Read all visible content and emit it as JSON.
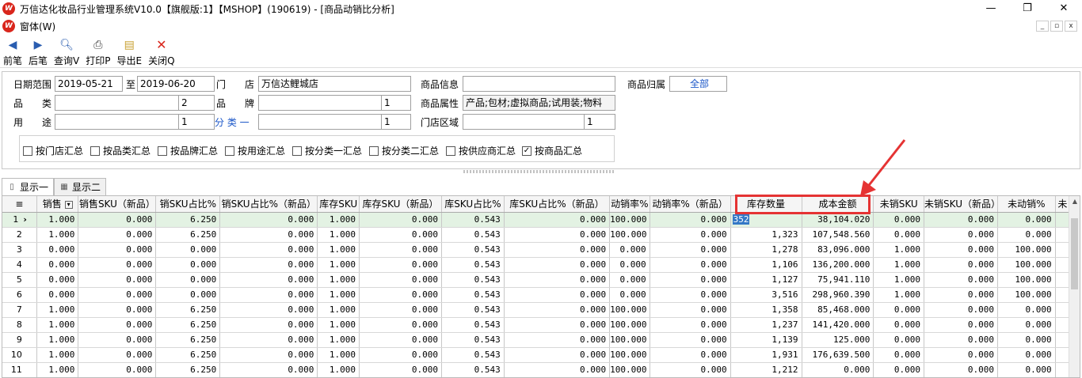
{
  "window": {
    "title": "万信达化妆品行业管理系统V10.0【旗舰版:1】【MSHOP】(190619) - [商品动销比分析]",
    "controls": [
      "—",
      "❐",
      "✕"
    ]
  },
  "menu": {
    "window_label": "窗体(W)",
    "mdi_controls": [
      "_",
      "▫",
      "x"
    ]
  },
  "toolbar": {
    "prev": "前笔",
    "next": "后笔",
    "query": "查询V",
    "print": "打印P",
    "export": "导出E",
    "close": "关闭Q"
  },
  "filter": {
    "date_range_label": "日期范围",
    "date_from": "2019-05-21",
    "to_label": "至",
    "date_to": "2019-06-20",
    "store_label": "门　　店",
    "store_value": "万信达鲤城店",
    "product_info_label": "商品信息",
    "product_info_value": "",
    "product_owner_label": "商品归属",
    "product_owner_value": "全部",
    "category_label": "品　　类",
    "category_num": "2",
    "brand_label": "品　　牌",
    "brand_num": "1",
    "product_attr_label": "商品属性",
    "product_attr_value": "产品;包材;虚拟商品;试用装;物料",
    "usage_label": "用　　途",
    "usage_num": "1",
    "class_label": "分 类 一",
    "class_num": "1",
    "area_label": "门店区域",
    "area_num": "1",
    "checkboxes": [
      {
        "label": "按门店汇总",
        "checked": false
      },
      {
        "label": "按品类汇总",
        "checked": false
      },
      {
        "label": "按品牌汇总",
        "checked": false
      },
      {
        "label": "按用途汇总",
        "checked": false
      },
      {
        "label": "按分类一汇总",
        "checked": false
      },
      {
        "label": "按分类二汇总",
        "checked": false
      },
      {
        "label": "按供应商汇总",
        "checked": false
      },
      {
        "label": "按商品汇总",
        "checked": true
      }
    ]
  },
  "tabs": [
    "显示一",
    "显示二"
  ],
  "grid": {
    "columns": [
      "销售",
      "销售SKU（新品）",
      "销SKU占比%",
      "销SKU占比%（新品）",
      "库存SKU",
      "库存SKU（新品）",
      "库SKU占比%",
      "库SKU占比%（新品）",
      "动销率%",
      "动销率%（新品）",
      "库存数量",
      "成本金额",
      "未销SKU",
      "未销SKU（新品）",
      "未动销%",
      "未"
    ],
    "rows": [
      [
        "1",
        "1.000",
        "0.000",
        "6.250",
        "0.000",
        "1.000",
        "0.000",
        "0.543",
        "0.000",
        "100.000",
        "0.000",
        "352",
        "38,104.020",
        "0.000",
        "0.000",
        "0.000"
      ],
      [
        "2",
        "1.000",
        "0.000",
        "6.250",
        "0.000",
        "1.000",
        "0.000",
        "0.543",
        "0.000",
        "100.000",
        "0.000",
        "1,323",
        "107,548.560",
        "0.000",
        "0.000",
        "0.000"
      ],
      [
        "3",
        "0.000",
        "0.000",
        "0.000",
        "0.000",
        "1.000",
        "0.000",
        "0.543",
        "0.000",
        "0.000",
        "0.000",
        "1,278",
        "83,096.000",
        "1.000",
        "0.000",
        "100.000"
      ],
      [
        "4",
        "0.000",
        "0.000",
        "0.000",
        "0.000",
        "1.000",
        "0.000",
        "0.543",
        "0.000",
        "0.000",
        "0.000",
        "1,106",
        "136,200.000",
        "1.000",
        "0.000",
        "100.000"
      ],
      [
        "5",
        "0.000",
        "0.000",
        "0.000",
        "0.000",
        "1.000",
        "0.000",
        "0.543",
        "0.000",
        "0.000",
        "0.000",
        "1,127",
        "75,941.110",
        "1.000",
        "0.000",
        "100.000"
      ],
      [
        "6",
        "0.000",
        "0.000",
        "0.000",
        "0.000",
        "1.000",
        "0.000",
        "0.543",
        "0.000",
        "0.000",
        "0.000",
        "3,516",
        "298,960.390",
        "1.000",
        "0.000",
        "100.000"
      ],
      [
        "7",
        "1.000",
        "0.000",
        "6.250",
        "0.000",
        "1.000",
        "0.000",
        "0.543",
        "0.000",
        "100.000",
        "0.000",
        "1,358",
        "85,468.000",
        "0.000",
        "0.000",
        "0.000"
      ],
      [
        "8",
        "1.000",
        "0.000",
        "6.250",
        "0.000",
        "1.000",
        "0.000",
        "0.543",
        "0.000",
        "100.000",
        "0.000",
        "1,237",
        "141,420.000",
        "0.000",
        "0.000",
        "0.000"
      ],
      [
        "9",
        "1.000",
        "0.000",
        "6.250",
        "0.000",
        "1.000",
        "0.000",
        "0.543",
        "0.000",
        "100.000",
        "0.000",
        "1,139",
        "125.000",
        "0.000",
        "0.000",
        "0.000"
      ],
      [
        "10",
        "1.000",
        "0.000",
        "6.250",
        "0.000",
        "1.000",
        "0.000",
        "0.543",
        "0.000",
        "100.000",
        "0.000",
        "1,931",
        "176,639.500",
        "0.000",
        "0.000",
        "0.000"
      ],
      [
        "11",
        "1.000",
        "0.000",
        "6.250",
        "0.000",
        "1.000",
        "0.000",
        "0.543",
        "0.000",
        "100.000",
        "0.000",
        "1,212",
        "0.000",
        "0.000",
        "0.000",
        "0.000"
      ]
    ]
  },
  "colors": {
    "annotation_red": "#e53333",
    "selected_row": "#e3f2e3",
    "cell_cursor": "#3478c6"
  }
}
